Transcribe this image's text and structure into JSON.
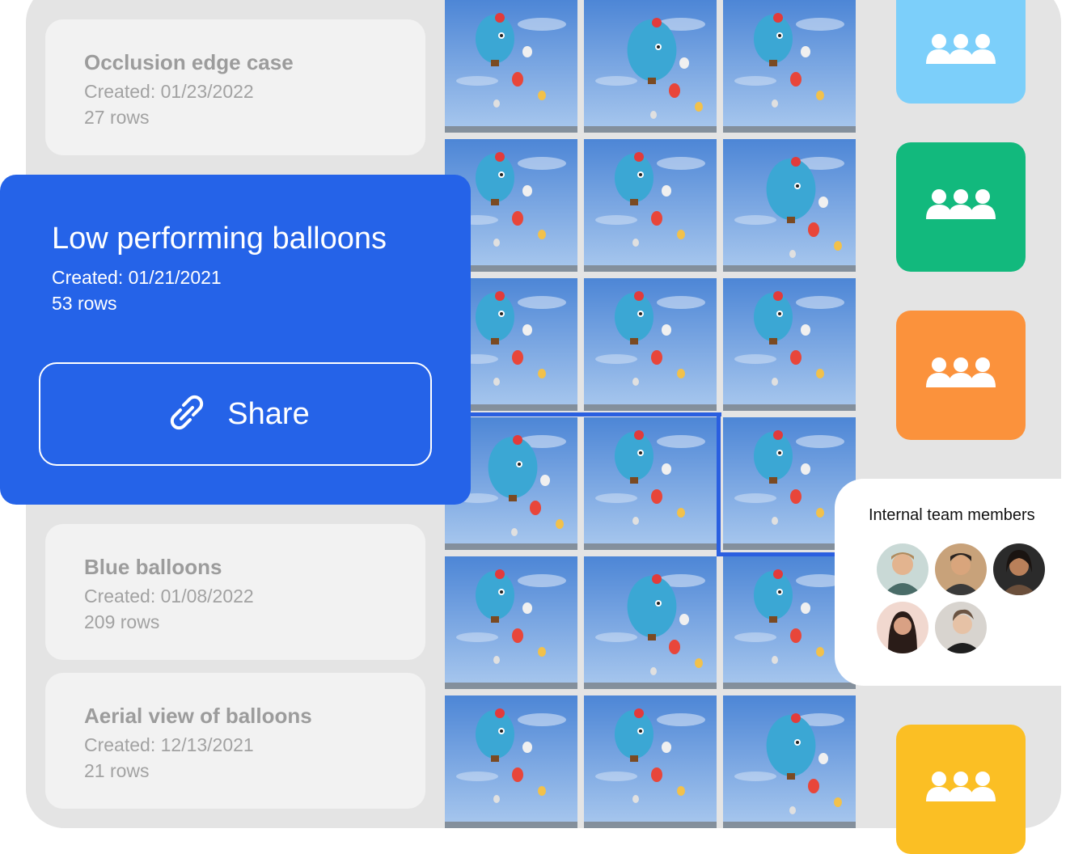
{
  "datasets": [
    {
      "title": "Occlusion edge case",
      "created": "Created: 01/23/2022",
      "rows": "27 rows"
    },
    {
      "title": "Low performing balloons",
      "created": "Created: 01/21/2021",
      "rows": "53 rows"
    },
    {
      "title": "Blue balloons",
      "created": "Created: 01/08/2022",
      "rows": "209 rows"
    },
    {
      "title": "Aerial view of balloons",
      "created": "Created: 12/13/2021",
      "rows": "21 rows"
    }
  ],
  "share": {
    "label": "Share",
    "icon": "link-icon"
  },
  "teams": {
    "colors": [
      "#7ccffa",
      "#12b97d",
      "#fb923c",
      "#fbbf24"
    ],
    "icon": "team-group-icon"
  },
  "members_panel": {
    "title": "Internal team members",
    "member_count": 5
  },
  "accent": "#2563e8"
}
